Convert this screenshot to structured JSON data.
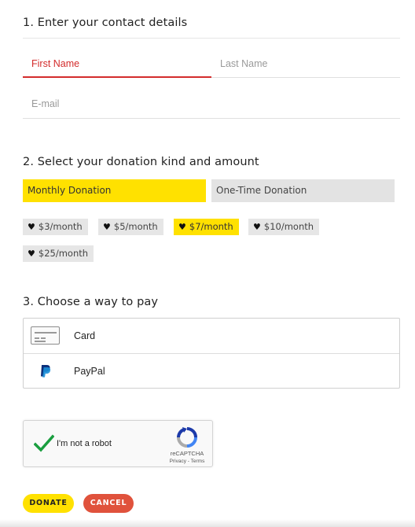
{
  "contact": {
    "title": "1. Enter your contact details",
    "first_name_placeholder": "First Name",
    "last_name_placeholder": "Last Name",
    "email_placeholder": "E-mail"
  },
  "donation": {
    "title": "2. Select your donation kind and amount",
    "kinds": [
      {
        "label": "Monthly Donation",
        "selected": true
      },
      {
        "label": "One-Time Donation",
        "selected": false
      }
    ],
    "amounts": [
      {
        "label": "$3/month",
        "selected": false
      },
      {
        "label": "$5/month",
        "selected": false
      },
      {
        "label": "$7/month",
        "selected": true
      },
      {
        "label": "$10/month",
        "selected": false
      },
      {
        "label": "$25/month",
        "selected": false
      }
    ]
  },
  "payment": {
    "title": "3. Choose a way to pay",
    "options": [
      {
        "label": "Card",
        "icon": "credit-card-icon"
      },
      {
        "label": "PayPal",
        "icon": "paypal-icon"
      }
    ]
  },
  "recaptcha": {
    "label": "I'm not a robot",
    "brand": "reCAPTCHA",
    "links": "Privacy - Terms",
    "checked": true
  },
  "actions": {
    "donate_label": "DONATE",
    "cancel_label": "CANCEL"
  },
  "colors": {
    "accent_yellow": "#ffe100",
    "error_red": "#d32c2c",
    "cancel_red": "#e0523c",
    "check_green": "#1a9e3f"
  }
}
